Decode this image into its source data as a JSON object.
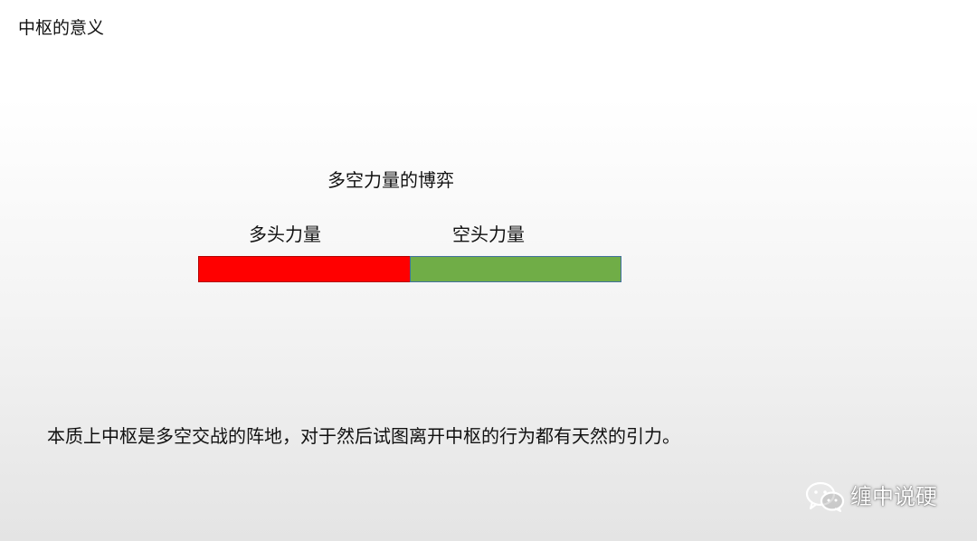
{
  "slide": {
    "title": "中枢的意义",
    "subtitle": "多空力量的博弈",
    "labels": {
      "long": "多头力量",
      "short": "空头力量"
    },
    "bar": {
      "segments": [
        {
          "name": "多头力量",
          "share": 0.5,
          "color": "#ff0000"
        },
        {
          "name": "空头力量",
          "share": 0.5,
          "color": "#70ad47"
        }
      ]
    },
    "statement": "本质上中枢是多空交战的阵地，对于然后试图离开中枢的行为都有天然的引力。"
  },
  "watermark": {
    "icon": "wechat-icon",
    "text": "缠中说硬"
  }
}
